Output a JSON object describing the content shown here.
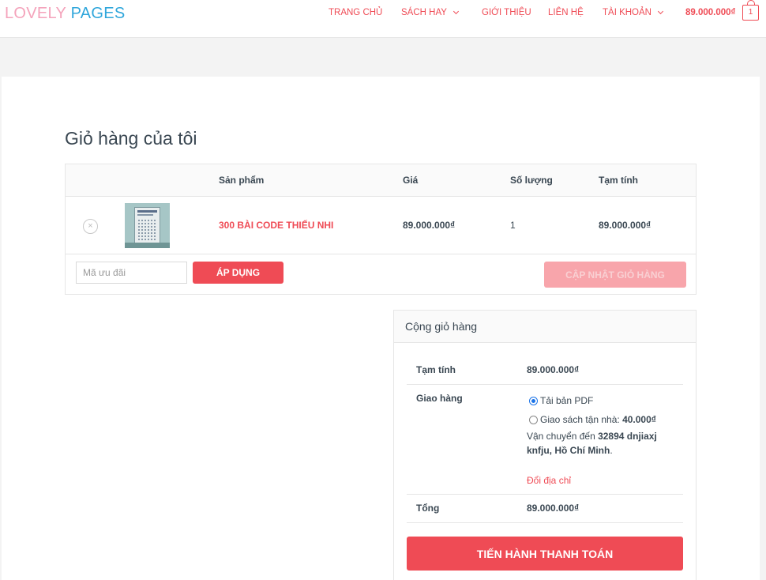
{
  "brand": {
    "part1": "LOVELY",
    "part2": "PAGES"
  },
  "nav": {
    "items": [
      {
        "label": "TRANG CHỦ"
      },
      {
        "label": "SÁCH HAY"
      },
      {
        "label": "GIỚI THIỆU"
      },
      {
        "label": "LIÊN HỆ"
      },
      {
        "label": "TÀI KHOẢN"
      }
    ],
    "cart_total": "89.000.000₫",
    "cart_count": "1"
  },
  "page": {
    "title": "Giỏ hàng của tôi"
  },
  "cart": {
    "columns": [
      "Sản phẩm",
      "Giá",
      "Số lượng",
      "Tạm tính"
    ],
    "rows": [
      {
        "remove_icon": "×",
        "product": "300 BÀI CODE THIẾU NHI",
        "price": "89.000.000₫",
        "quantity": "1",
        "subtotal": "89.000.000₫"
      }
    ],
    "coupon_placeholder": "Mã ưu đãi",
    "apply_label": "ÁP DỤNG",
    "update_label": "CẬP NHẬT GIỎ HÀNG"
  },
  "totals": {
    "title": "Cộng giỏ hàng",
    "subtotal_label": "Tạm tính",
    "subtotal_value": "89.000.000₫",
    "shipping_label": "Giao hàng",
    "shipping_options": [
      {
        "label": "Tải bản PDF",
        "selected": true
      },
      {
        "label": "Giao sách tận nhà: ",
        "price": "40.000₫",
        "selected": false
      }
    ],
    "ship_to_prefix": "Vận chuyển đến ",
    "ship_to_address_line1": "32894 dnjiaxj",
    "ship_to_address_line2": "knfju, Hồ Chí Minh",
    "ship_to_suffix": ".",
    "change_address": "Đổi địa chỉ",
    "total_label": "Tổng",
    "total_value": "89.000.000₫",
    "checkout_label": "TIẾN HÀNH THANH TOÁN"
  },
  "colors": {
    "accent": "#ef4b55",
    "brand_pink": "#f4a3bb",
    "brand_blue": "#2fa6db"
  }
}
